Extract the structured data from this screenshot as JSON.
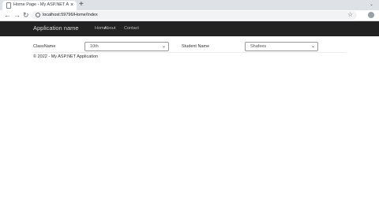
{
  "browser": {
    "tab_title": "Home Page - My ASP.NET Appli",
    "tab_close": "×",
    "new_tab": "+",
    "url": "localhost:59796/Home/Index",
    "back": "←",
    "forward": "→",
    "reload": "↻",
    "star": "☆",
    "chevron": "⌄",
    "icons": [
      "document-icon",
      "info-icon",
      "star-icon",
      "profile-icon"
    ]
  },
  "navbar": {
    "brand": "Application name",
    "links": [
      "Home",
      "About",
      "Contact"
    ],
    "background": "#222222"
  },
  "form": {
    "class_label": "ClassName",
    "class_value": "10th",
    "student_label": "Student Name",
    "student_value": "Shafees",
    "chevron": "⌄"
  },
  "footer": {
    "text": "© 2022 - My ASP.NET Application"
  }
}
